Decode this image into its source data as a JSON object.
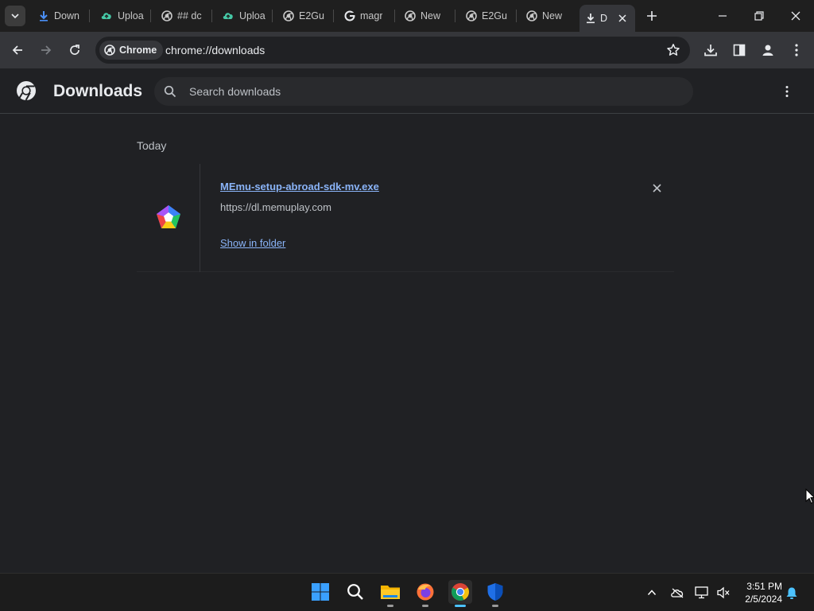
{
  "tabs": [
    {
      "label": "Down",
      "icon": "download-arrow-icon"
    },
    {
      "label": "Uploa",
      "icon": "cloud-upload-icon"
    },
    {
      "label": "## dc",
      "icon": "chromium-globe-icon"
    },
    {
      "label": "Uploa",
      "icon": "cloud-upload-icon"
    },
    {
      "label": "E2Gu",
      "icon": "chromium-globe-icon"
    },
    {
      "label": "magr",
      "icon": "google-g-icon"
    },
    {
      "label": "New",
      "icon": "chrome-new-tab-icon"
    },
    {
      "label": "E2Gu",
      "icon": "chromium-globe-icon"
    },
    {
      "label": "New",
      "icon": "chrome-new-tab-icon"
    },
    {
      "label": "D",
      "icon": "download-arrow-icon",
      "active": true
    }
  ],
  "toolbar": {
    "site_chip": "Chrome",
    "url": "chrome://downloads"
  },
  "downloads": {
    "title": "Downloads",
    "search_placeholder": "Search downloads",
    "date_heading": "Today",
    "items": [
      {
        "file_name": "MEmu-setup-abroad-sdk-mv.exe",
        "source_url": "https://dl.memuplay.com",
        "action": "Show in folder"
      }
    ]
  },
  "taskbar": {
    "apps": [
      "start-icon",
      "search-icon",
      "file-explorer-icon",
      "firefox-icon",
      "chrome-icon",
      "defender-icon"
    ],
    "clock_time": "3:51 PM",
    "clock_date": "2/5/2024"
  },
  "colors": {
    "background": "#202124",
    "toolbar": "#35363a",
    "link": "#8ab4f8",
    "text_secondary": "#bdc1c6"
  }
}
